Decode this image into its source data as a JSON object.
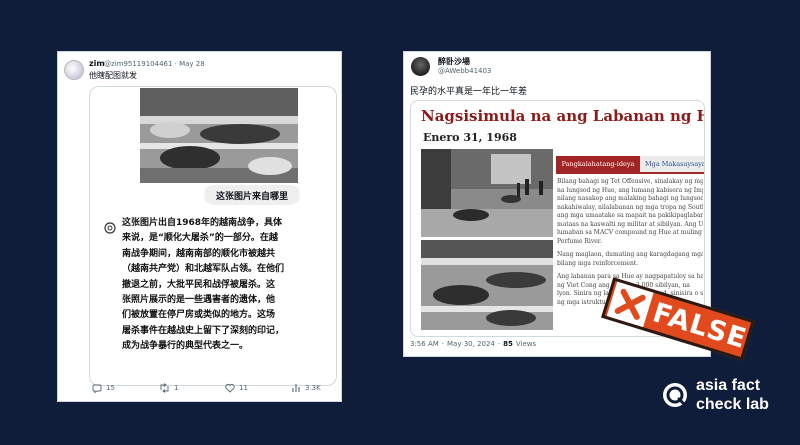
{
  "left_tweet": {
    "display_name": "zim",
    "handle_date": "@zim95119104461 · May 28",
    "text": "他瞎配图就发",
    "embed": {
      "question": "这张图片来自哪里",
      "answer_lines": [
        "这张图片出自1968年的越南战争，具体",
        "来说，是“顺化大屠杀”的一部分。在越",
        "南战争期间，越南南部的顺化市被越共",
        "（越南共产党）和北越军队占领。在他们",
        "撤退之前，大批平民和战俘被屠杀。这",
        "张照片展示的是一些遇害者的遗体，他",
        "们被放置在停尸房或类似的地方。这场",
        "屠杀事件在越战史上留下了深刻的印记，",
        "成为战争暴行的典型代表之一。"
      ]
    },
    "metrics": {
      "replies": "15",
      "retweets": "1",
      "likes": "11",
      "views": "3.3K"
    }
  },
  "right_tweet": {
    "display_name": "醉卧沙場",
    "handle": "@AWebb41403",
    "text": "民孕的水平真是一年比一年差",
    "article": {
      "title": "Nagsisimula na ang Labanan ng Hue",
      "date": "Enero 31, 1968",
      "tabs": [
        "Pangkalahatang-ideya",
        "Mga Makasaysayang"
      ],
      "paragraph1": [
        "Bilang bahagi ng Tet Offensive, sinalakay ng mga",
        "na lungsod ng Hue, ang lumang kabisera ng Imper",
        "nilang nasakop ang malaking bahagi ng lungsod",
        "nakahiwalay, nilalabanan ng mga tropa ng South",
        "ang mga umaatake sa mapait na pakikipaglaban",
        "mataas na kaswalti ng militar at sibilyan. Ang US",
        "lumaban sa MACV compound ng Hue at muling k",
        "Perfume River."
      ],
      "paragraph2": [
        "Nang maglaon, dumating ang karagdagang mga",
        "bilang mga reinforcement."
      ],
      "paragraph3": [
        "Ang labanan para sa Hue ay nagpapatuloy sa halo",
        "ng Viet Cong ang higit sa 3,000 sibilyan, na",
        "lyon. Sinira ng labanan ang lungsod, sinisira o si",
        "ng mga istruktura ng tirahan"
      ]
    },
    "meta": {
      "time": "3:56 AM",
      "date": "May 30, 2024",
      "dot": "·",
      "views_count": "85",
      "views_label": "Views"
    }
  },
  "stamp": {
    "label": "FALSE",
    "color": "#e04a1c"
  },
  "logo": {
    "line1": "asia fact",
    "line2": "check lab"
  }
}
